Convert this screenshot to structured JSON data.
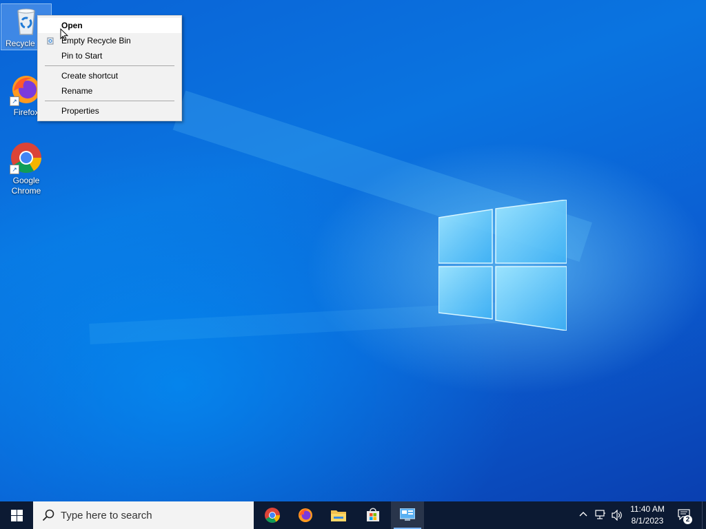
{
  "desktop": {
    "icons": [
      {
        "label": "Recycle Bin",
        "icon": "recycle-bin-icon",
        "visible_label": "Recycle"
      },
      {
        "label": "Firefox",
        "icon": "firefox-icon"
      },
      {
        "label": "Google Chrome",
        "icon": "chrome-icon",
        "line1": "Google",
        "line2": "Chrome"
      }
    ]
  },
  "context_menu": {
    "items": [
      {
        "label": "Open",
        "default": true
      },
      {
        "label": "Empty Recycle Bin",
        "icon": "recycle-bin-small-icon"
      },
      {
        "label": "Pin to Start"
      },
      {
        "label": "Create shortcut"
      },
      {
        "label": "Rename"
      },
      {
        "label": "Properties"
      }
    ]
  },
  "taskbar": {
    "search_placeholder": "Type here to search",
    "apps": [
      "chrome-icon",
      "firefox-icon",
      "file-explorer-icon",
      "microsoft-store-icon",
      "control-panel-icon"
    ],
    "clock": {
      "time": "11:40 AM",
      "date": "8/1/2023"
    },
    "notification_count": "2"
  },
  "colors": {
    "taskbar": "#0c1a33",
    "desktop_blue": "#0a63d6",
    "menu_bg": "#f2f2f2"
  }
}
